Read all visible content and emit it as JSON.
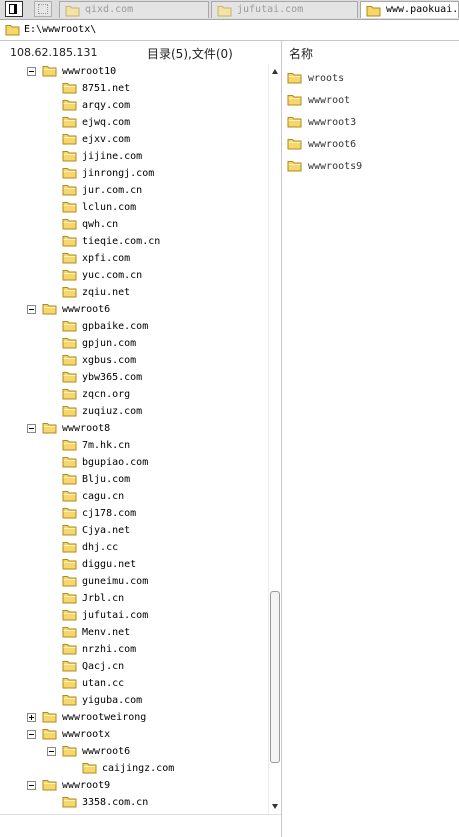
{
  "tabs": [
    {
      "label": "qixd.com",
      "active": false
    },
    {
      "label": "jufutai.com",
      "active": false
    },
    {
      "label": "www.paokuai.co",
      "active": true
    }
  ],
  "path": "E:\\wwwrootx\\",
  "header": {
    "ip": "108.62.185.131",
    "summary": "目录(5),文件(0)",
    "column_name": "名称"
  },
  "colors": {
    "folder_fill": "#f7d66a",
    "folder_stroke": "#b08a1e",
    "border": "#c8c8c8"
  },
  "tree": [
    {
      "label": "wwwroot10",
      "level": 0,
      "expander": "minus"
    },
    {
      "label": "8751.net",
      "level": 1
    },
    {
      "label": "arqy.com",
      "level": 1
    },
    {
      "label": "ejwq.com",
      "level": 1
    },
    {
      "label": "ejxv.com",
      "level": 1
    },
    {
      "label": "jijine.com",
      "level": 1
    },
    {
      "label": "jinrongj.com",
      "level": 1
    },
    {
      "label": "jur.com.cn",
      "level": 1
    },
    {
      "label": "lclun.com",
      "level": 1
    },
    {
      "label": "qwh.cn",
      "level": 1
    },
    {
      "label": "tieqie.com.cn",
      "level": 1
    },
    {
      "label": "xpfi.com",
      "level": 1
    },
    {
      "label": "yuc.com.cn",
      "level": 1
    },
    {
      "label": "zqiu.net",
      "level": 1
    },
    {
      "label": "wwwroot6",
      "level": 0,
      "expander": "minus"
    },
    {
      "label": "gpbaike.com",
      "level": 1
    },
    {
      "label": "gpjun.com",
      "level": 1
    },
    {
      "label": "xgbus.com",
      "level": 1
    },
    {
      "label": "ybw365.com",
      "level": 1
    },
    {
      "label": "zqcn.org",
      "level": 1
    },
    {
      "label": "zuqiuz.com",
      "level": 1
    },
    {
      "label": "wwwroot8",
      "level": 0,
      "expander": "minus"
    },
    {
      "label": "7m.hk.cn",
      "level": 1
    },
    {
      "label": "bgupiao.com",
      "level": 1
    },
    {
      "label": "Blju.com",
      "level": 1
    },
    {
      "label": "cagu.cn",
      "level": 1
    },
    {
      "label": "cj178.com",
      "level": 1
    },
    {
      "label": "Cjya.net",
      "level": 1
    },
    {
      "label": "dhj.cc",
      "level": 1
    },
    {
      "label": "diggu.net",
      "level": 1
    },
    {
      "label": "guneimu.com",
      "level": 1
    },
    {
      "label": "Jrbl.cn",
      "level": 1
    },
    {
      "label": "jufutai.com",
      "level": 1
    },
    {
      "label": "Menv.net",
      "level": 1
    },
    {
      "label": "nrzhi.com",
      "level": 1
    },
    {
      "label": "Qacj.cn",
      "level": 1
    },
    {
      "label": "utan.cc",
      "level": 1
    },
    {
      "label": "yiguba.com",
      "level": 1
    },
    {
      "label": "wwwrootweirong",
      "level": 0,
      "expander": "plus"
    },
    {
      "label": "wwwrootx",
      "level": 0,
      "expander": "minus"
    },
    {
      "label": "wwwroot6",
      "level": 1,
      "expander": "minus"
    },
    {
      "label": "caijingz.com",
      "level": 2
    },
    {
      "label": "wwwroot9",
      "level": 0,
      "expander": "minus"
    },
    {
      "label": "3358.com.cn",
      "level": 1
    }
  ],
  "right_items": [
    {
      "label": "wroots"
    },
    {
      "label": "wwwroot"
    },
    {
      "label": "wwwroot3"
    },
    {
      "label": "wwwroot6"
    },
    {
      "label": "wwwroots9"
    }
  ]
}
